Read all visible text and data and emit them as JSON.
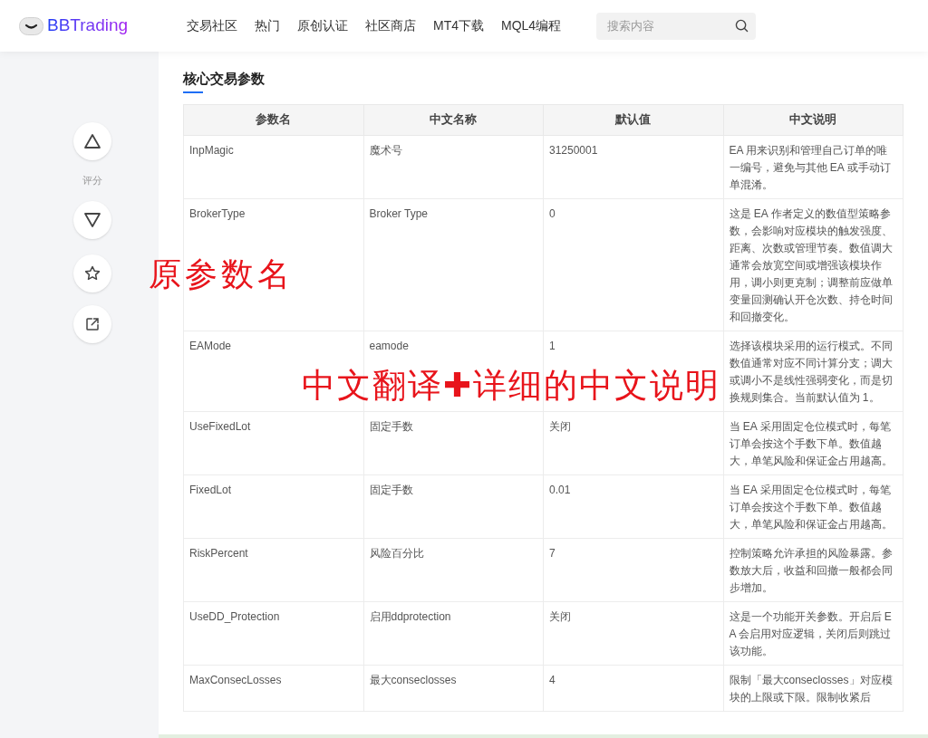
{
  "header": {
    "logo": "BBTrading",
    "nav": [
      {
        "label": "交易社区"
      },
      {
        "label": "热门"
      },
      {
        "label": "原创认证"
      },
      {
        "label": "社区商店"
      },
      {
        "label": "MT4下载"
      },
      {
        "label": "MQL4编程"
      }
    ],
    "search": {
      "placeholder": "搜索内容"
    }
  },
  "sidebar": {
    "rating_label": "评分"
  },
  "section": {
    "title": "核心交易参数"
  },
  "table": {
    "columns": [
      "参数名",
      "中文名称",
      "默认值",
      "中文说明"
    ],
    "rows": [
      [
        "InpMagic",
        "魔术号",
        "31250001",
        "EA 用来识别和管理自己订单的唯一编号，避免与其他 EA 或手动订单混淆。"
      ],
      [
        "BrokerType",
        "Broker Type",
        "0",
        "这是 EA 作者定义的数值型策略参数，会影响对应模块的触发强度、距离、次数或管理节奏。数值调大通常会放宽空间或增强该模块作用，调小则更克制；调整前应做单变量回测确认开仓次数、持仓时间和回撤变化。"
      ],
      [
        "EAMode",
        "eamode",
        "1",
        "选择该模块采用的运行模式。不同数值通常对应不同计算分支；调大或调小不是线性强弱变化，而是切换规则集合。当前默认值为 1。"
      ],
      [
        "UseFixedLot",
        "固定手数",
        "关闭",
        "当 EA 采用固定仓位模式时，每笔订单会按这个手数下单。数值越大，单笔风险和保证金占用越高。"
      ],
      [
        "FixedLot",
        "固定手数",
        "0.01",
        "当 EA 采用固定仓位模式时，每笔订单会按这个手数下单。数值越大，单笔风险和保证金占用越高。"
      ],
      [
        "RiskPercent",
        "风险百分比",
        "7",
        "控制策略允许承担的风险暴露。参数放大后，收益和回撤一般都会同步增加。"
      ],
      [
        "UseDD_Protection",
        "启用ddprotection",
        "关闭",
        "这是一个功能开关参数。开启后 EA 会启用对应逻辑，关闭后则跳过该功能。"
      ],
      [
        "MaxConsecLosses",
        "最大conseclosses",
        "4",
        "限制「最大conseclosses」对应模块的上限或下限。限制收紧后"
      ]
    ]
  },
  "annotations": [
    {
      "kind": "left",
      "text": "原参数名"
    },
    {
      "kind": "center",
      "text": "中文翻译✚详细的中文说明"
    }
  ]
}
